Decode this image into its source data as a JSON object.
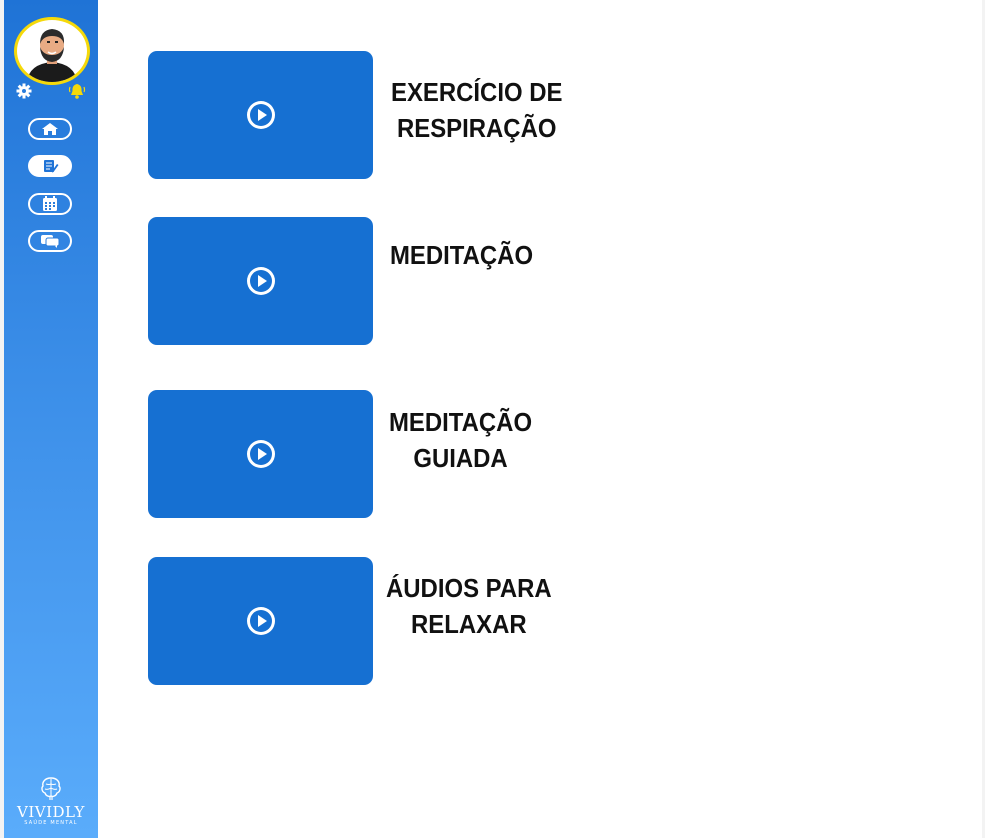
{
  "sidebar": {
    "avatar_icon": "user-avatar",
    "settings_icon": "gear-icon",
    "notifications_icon": "bell-icon",
    "nav": [
      {
        "id": "home",
        "icon": "home-icon",
        "active": false
      },
      {
        "id": "notes",
        "icon": "notes-icon",
        "active": true
      },
      {
        "id": "calendar",
        "icon": "calendar-icon",
        "active": false
      },
      {
        "id": "chat",
        "icon": "chat-icon",
        "active": false
      }
    ],
    "logo": {
      "name": "VIVIDLY",
      "tagline": "SAÚDE MENTAL",
      "icon": "brain-icon"
    }
  },
  "content": {
    "items": [
      {
        "id": "breathing",
        "title_lines": [
          "EXERCÍCIO DE",
          "RESPIRAÇÃO"
        ],
        "icon": "play-icon"
      },
      {
        "id": "meditation",
        "title_lines": [
          "MEDITAÇÃO"
        ],
        "icon": "play-icon"
      },
      {
        "id": "guided",
        "title_lines": [
          "MEDITAÇÃO",
          "GUIADA"
        ],
        "icon": "play-icon"
      },
      {
        "id": "audios",
        "title_lines": [
          "ÁUDIOS PARA",
          "RELAXAR"
        ],
        "icon": "play-icon"
      }
    ]
  },
  "colors": {
    "sidebar_top": "#1f73d6",
    "sidebar_bottom": "#5aacfb",
    "card": "#1670d2",
    "avatar_ring": "#f5d90a",
    "bell": "#f5d90a",
    "text": "#111111"
  }
}
